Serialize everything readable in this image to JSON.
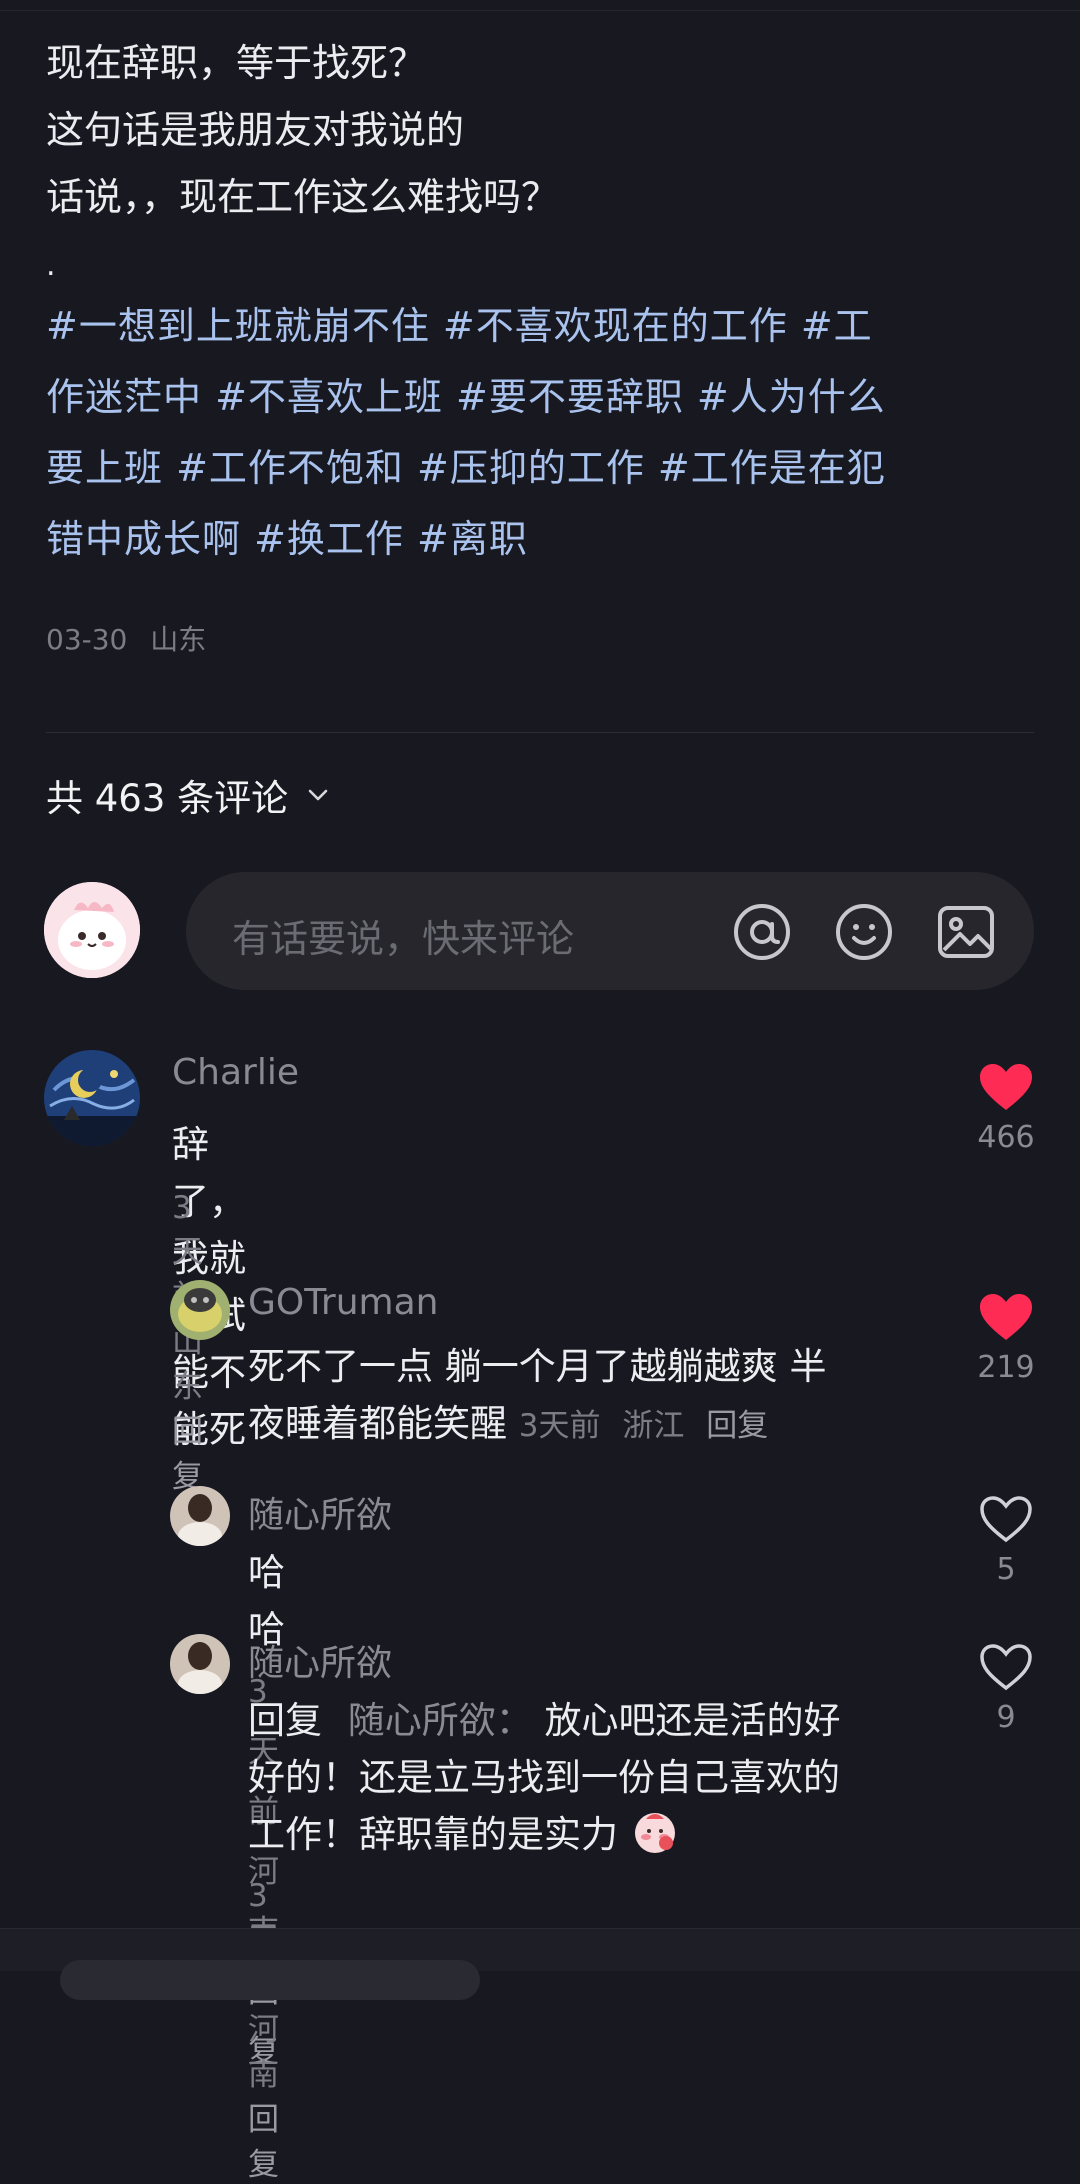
{
  "post": {
    "lines": [
      "现在辞职，等于找死？",
      "这句话是我朋友对我说的",
      "话说，，现在工作这么难找吗？"
    ],
    "dot": ".",
    "hashtags_lines": [
      "#一想到上班就崩不住 #不喜欢现在的工作 #工",
      "作迷茫中 #不喜欢上班 #要不要辞职 #人为什么",
      "要上班 #工作不饱和 #压抑的工作 #工作是在犯",
      "错中成长啊 #换工作 #离职"
    ],
    "date": "03-30",
    "location": "山东"
  },
  "comments_header": {
    "label": "共 463 条评论"
  },
  "input": {
    "placeholder": "有话要说，快来评论"
  },
  "comments": [
    {
      "user": "Charlie",
      "text": "辞了，我就试试能不能死",
      "time": "3天前",
      "location": "山东",
      "reply": "回复",
      "likes": "466",
      "liked": true,
      "replies": [
        {
          "user": "GOTruman",
          "text_line1": "死不了一点 躺一个月了越躺越爽 半",
          "text_line2": "夜睡着都能笑醒",
          "time": "3天前",
          "location": "浙江",
          "reply": "回复",
          "likes": "219",
          "liked": true
        },
        {
          "user": "随心所欲",
          "text": "哈哈",
          "time": "3天前",
          "location": "河南",
          "reply": "回复",
          "likes": "5",
          "liked": false
        },
        {
          "user": "随心所欲",
          "reply_prefix": "回复",
          "reply_to": "随心所欲：",
          "text_line1": "放心吧还是活的好",
          "text_line2": "好的！还是立马找到一份自己喜欢的",
          "text_line3": "工作！辞职靠的是实力",
          "time": "3天前",
          "location": "河南",
          "reply": "回复",
          "likes": "9",
          "liked": false
        }
      ]
    }
  ],
  "colors": {
    "background": "#181820",
    "hashtag": "#a9c3ee",
    "like_red": "#fe2c55",
    "muted": "#7c7c86"
  }
}
